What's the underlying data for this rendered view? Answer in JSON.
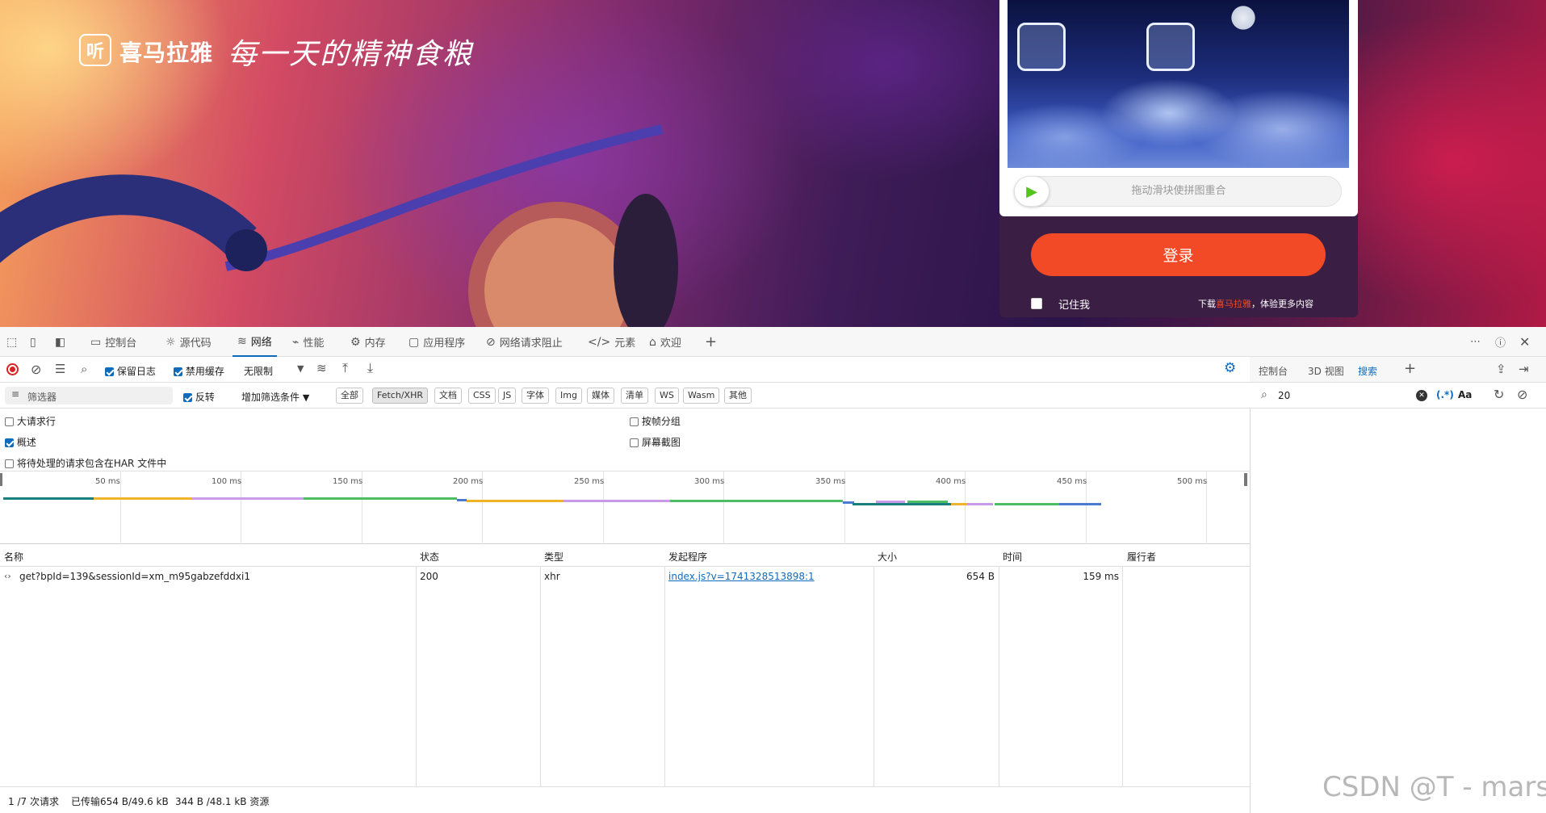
{
  "hero": {
    "logo_mark": "听",
    "logo_text": "喜马拉雅",
    "slogan": "每一天的精神食粮"
  },
  "login": {
    "slider_text": "拖动滑块使拼图重合",
    "login_button": "登录",
    "remember_label": "记住我",
    "download_prefix": "下载",
    "download_brand": "喜马拉雅",
    "download_suffix": "，体验更多内容",
    "accent_color": "#f24a26"
  },
  "devtools": {
    "tabs": [
      {
        "label": "控制台",
        "icon": "console-icon"
      },
      {
        "label": "源代码",
        "icon": "bug-icon"
      },
      {
        "label": "网络",
        "icon": "wifi-icon",
        "active": true
      },
      {
        "label": "性能",
        "icon": "performance-icon"
      },
      {
        "label": "内存",
        "icon": "memory-icon"
      },
      {
        "label": "应用程序",
        "icon": "application-icon"
      },
      {
        "label": "网络请求阻止",
        "icon": "block-icon"
      },
      {
        "label": "元素",
        "icon": "code-icon"
      },
      {
        "label": "欢迎",
        "icon": "home-icon"
      }
    ],
    "toolbar": {
      "preserve_log": "保留日志",
      "preserve_log_checked": true,
      "disable_cache": "禁用缓存",
      "disable_cache_checked": true,
      "throttle": "无限制"
    },
    "filter": {
      "placeholder": "筛选器",
      "invert": "反转",
      "invert_checked": true,
      "add_filter": "增加筛选条件",
      "types": [
        "全部",
        "Fetch/XHR",
        "文档",
        "CSS",
        "JS",
        "字体",
        "Img",
        "媒体",
        "清单",
        "WS",
        "Wasm",
        "其他"
      ],
      "active_type": "Fetch/XHR"
    },
    "options": {
      "big_rows": "大请求行",
      "big_rows_checked": false,
      "overview": "概述",
      "overview_checked": true,
      "har": "将待处理的请求包含在HAR 文件中",
      "har_checked": false,
      "group_by_frame": "按帧分组",
      "group_by_frame_checked": false,
      "screenshots": "屏幕截图",
      "screenshots_checked": false
    },
    "timeline_ticks": [
      "50 ms",
      "100 ms",
      "150 ms",
      "200 ms",
      "250 ms",
      "300 ms",
      "350 ms",
      "400 ms",
      "450 ms",
      "500 ms"
    ],
    "columns": [
      "名称",
      "状态",
      "类型",
      "发起程序",
      "大小",
      "时间",
      "履行者"
    ],
    "rows": [
      {
        "name": "get?bpId=139&sessionId=xm_m95gabzefddxi1",
        "status": "200",
        "type": "xhr",
        "initiator": "index.js?v=1741328513898:1",
        "size": "654 B",
        "time": "159 ms",
        "fulfilled_by": ""
      }
    ],
    "status": {
      "requests": "1 /7 次请求",
      "transferred": "已传输654 B/49.6 kB",
      "resources": "344 B /48.1 kB 资源"
    }
  },
  "right_panel": {
    "tabs": [
      "控制台",
      "3D 视图",
      "搜索"
    ],
    "active_tab": "搜索",
    "search_value": "20",
    "regex_label": "(.*)",
    "case_label": "Aa"
  },
  "watermark": "CSDN @T - mars"
}
